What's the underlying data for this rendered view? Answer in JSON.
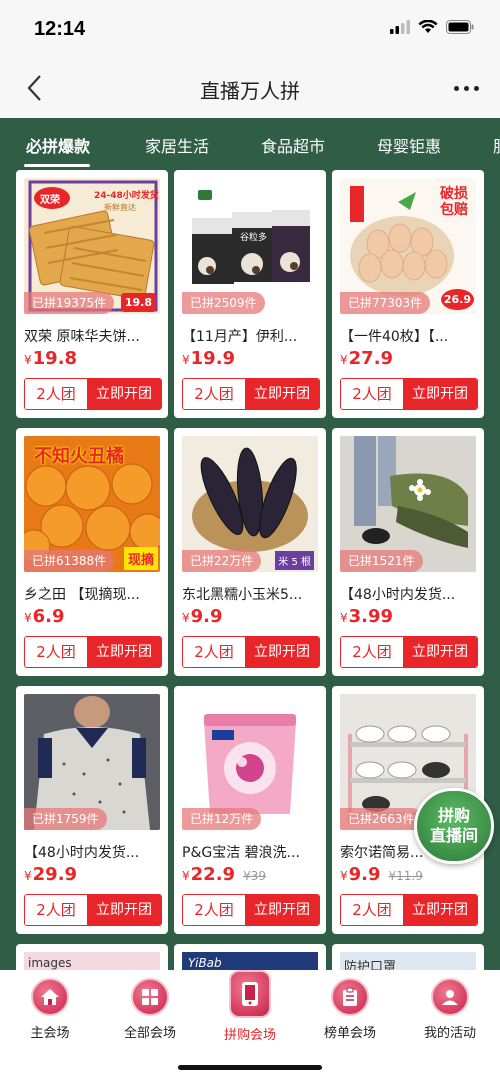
{
  "status": {
    "time": "12:14"
  },
  "header": {
    "title": "直播万人拼"
  },
  "tabs": [
    {
      "label": "必拼爆款",
      "active": true
    },
    {
      "label": "家居生活"
    },
    {
      "label": "食品超市"
    },
    {
      "label": "母婴钜惠"
    },
    {
      "label": "服"
    }
  ],
  "products": [
    {
      "title": "双荣 原味华夫饼...",
      "currency": "¥",
      "price": "19.8",
      "joined": "已拼19375件",
      "group_label": "2人团",
      "open_label": "立即开团",
      "img_text": [
        "双荣",
        "24-48小时发货",
        "新鲜直达"
      ],
      "img_price": "19.8"
    },
    {
      "title": "【11月产】伊利...",
      "currency": "¥",
      "price": "19.9",
      "joined": "已拼2509件",
      "group_label": "2人团",
      "open_label": "立即开团",
      "img_text": [
        "谷粒多"
      ]
    },
    {
      "title": "【一件40枚】【...",
      "currency": "¥",
      "price": "27.9",
      "joined": "已拼77303件",
      "group_label": "2人团",
      "open_label": "立即开团",
      "img_text": [
        "破损",
        "包赔"
      ],
      "img_price": "26.9"
    },
    {
      "title": "乡之田 【现摘现...",
      "currency": "¥",
      "price": "6.9",
      "joined": "已拼61388件",
      "group_label": "2人团",
      "open_label": "立即开团",
      "img_text": [
        "不知火丑橘",
        "现摘"
      ]
    },
    {
      "title": "东北黑糯小玉米5...",
      "currency": "¥",
      "price": "9.9",
      "joined": "已拼22万件",
      "group_label": "2人团",
      "open_label": "立即开团",
      "img_text": [
        "米 5 根"
      ]
    },
    {
      "title": "【48小时内发货...",
      "currency": "¥",
      "price": "3.99",
      "joined": "已拼1521件",
      "group_label": "2人团",
      "open_label": "立即开团"
    },
    {
      "title": "【48小时内发货...",
      "currency": "¥",
      "price": "29.9",
      "joined": "已拼1759件",
      "group_label": "2人团",
      "open_label": "立即开团"
    },
    {
      "title": "P&G宝洁 碧浪洗...",
      "currency": "¥",
      "price": "22.9",
      "orig_price": "¥39",
      "joined": "已拼12万件",
      "group_label": "2人团",
      "open_label": "立即开团"
    },
    {
      "title": "索尔诺简易...",
      "currency": "¥",
      "price": "9.9",
      "orig_price": "¥11.9",
      "joined": "已拼2663件",
      "group_label": "2人团",
      "open_label": "立即开团"
    }
  ],
  "peek": [
    {
      "text": "images"
    },
    {
      "text": "YiBab"
    },
    {
      "text": "防护口罩"
    }
  ],
  "live_badge": {
    "line1": "拼购",
    "line2": "直播间"
  },
  "bottom_nav": [
    {
      "label": "主会场",
      "icon": "home-icon"
    },
    {
      "label": "全部会场",
      "icon": "grid-icon"
    },
    {
      "label": "拼购会场",
      "icon": "phone-icon",
      "active": true
    },
    {
      "label": "榜单会场",
      "icon": "clipboard-icon"
    },
    {
      "label": "我的活动",
      "icon": "user-icon"
    }
  ],
  "colors": {
    "accent": "#e8262a",
    "tab_bg": "#2f5d45"
  }
}
